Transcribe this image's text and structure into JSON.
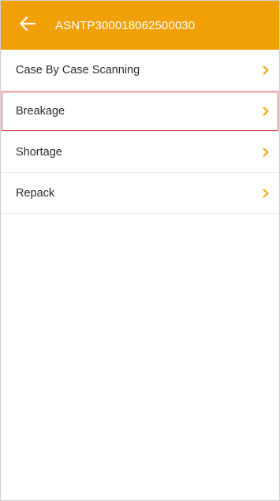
{
  "header": {
    "title": "ASNTP300018062500030",
    "back_icon": "arrow-left-icon",
    "background_color": "#f2a007"
  },
  "menu": {
    "items": [
      {
        "label": "Case By Case Scanning",
        "icon": "chevron-right-icon",
        "selected": false
      },
      {
        "label": "Breakage",
        "icon": "chevron-right-icon",
        "selected": true
      },
      {
        "label": "Shortage",
        "icon": "chevron-right-icon",
        "selected": false
      },
      {
        "label": "Repack",
        "icon": "chevron-right-icon",
        "selected": false
      }
    ],
    "chevron_color": "#f2a007",
    "selected_border_color": "#e0404a"
  }
}
